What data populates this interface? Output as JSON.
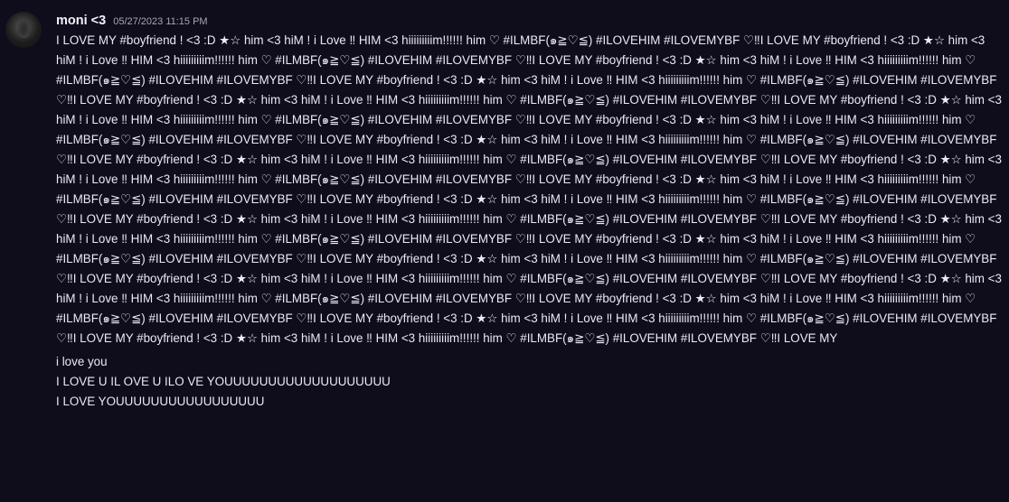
{
  "message": {
    "author": "moni <3",
    "timestamp": "05/27/2023 11:15 PM",
    "avatar_icon": "avatar-icon",
    "body": "I LOVE MY #boyfriend ! <3 :D ★☆ him <3 hiM ! i Love ‼ HIM <3 hiiiiiiiiim!!!!!! him ♡ #ILMBF(๑≧♡≦) #ILOVEHIM #ILOVEMYBF ♡‼I LOVE MY #boyfriend ! <3 :D ★☆ him <3 hiM ! i Love ‼ HIM <3 hiiiiiiiiim!!!!!! him ♡ #ILMBF(๑≧♡≦) #ILOVEHIM #ILOVEMYBF ♡‼I LOVE MY #boyfriend ! <3 :D ★☆ him <3 hiM ! i Love ‼ HIM <3 hiiiiiiiiim!!!!!! him ♡ #ILMBF(๑≧♡≦) #ILOVEHIM #ILOVEMYBF ♡‼I LOVE MY #boyfriend ! <3 :D ★☆ him <3 hiM ! i Love ‼ HIM <3 hiiiiiiiiim!!!!!! him ♡ #ILMBF(๑≧♡≦) #ILOVEHIM #ILOVEMYBF ♡‼I LOVE MY #boyfriend ! <3 :D ★☆ him <3 hiM ! i Love ‼ HIM <3 hiiiiiiiiim!!!!!! him ♡ #ILMBF(๑≧♡≦) #ILOVEHIM #ILOVEMYBF ♡‼I LOVE MY #boyfriend ! <3 :D ★☆ him <3 hiM ! i Love ‼ HIM <3 hiiiiiiiiim!!!!!! him ♡ #ILMBF(๑≧♡≦) #ILOVEHIM #ILOVEMYBF ♡‼I LOVE MY #boyfriend ! <3 :D ★☆ him <3 hiM ! i Love ‼ HIM <3 hiiiiiiiiim!!!!!! him ♡ #ILMBF(๑≧♡≦) #ILOVEHIM #ILOVEMYBF ♡‼I LOVE MY #boyfriend ! <3 :D ★☆ him <3 hiM ! i Love ‼ HIM <3 hiiiiiiiiim!!!!!! him ♡ #ILMBF(๑≧♡≦) #ILOVEHIM #ILOVEMYBF ♡‼I LOVE MY #boyfriend ! <3 :D ★☆ him <3 hiM ! i Love ‼ HIM <3 hiiiiiiiiim!!!!!! him ♡ #ILMBF(๑≧♡≦) #ILOVEHIM #ILOVEMYBF ♡‼I LOVE MY #boyfriend ! <3 :D ★☆ him <3 hiM ! i Love ‼ HIM <3 hiiiiiiiiim!!!!!! him ♡ #ILMBF(๑≧♡≦) #ILOVEHIM #ILOVEMYBF ♡‼I LOVE MY #boyfriend ! <3 :D ★☆ him <3 hiM ! i Love ‼ HIM <3 hiiiiiiiiim!!!!!! him ♡ #ILMBF(๑≧♡≦) #ILOVEHIM #ILOVEMYBF ♡‼I LOVE MY #boyfriend ! <3 :D ★☆ him <3 hiM ! i Love ‼ HIM <3 hiiiiiiiiim!!!!!! him ♡ #ILMBF(๑≧♡≦) #ILOVEHIM #ILOVEMYBF ♡‼I LOVE MY #boyfriend ! <3 :D ★☆ him <3 hiM ! i Love ‼ HIM <3 hiiiiiiiiim!!!!!! him ♡ #ILMBF(๑≧♡≦) #ILOVEHIM #ILOVEMYBF ♡‼I LOVE MY #boyfriend ! <3 :D ★☆ him <3 hiM ! i Love ‼ HIM <3 hiiiiiiiiim!!!!!! him ♡ #ILMBF(๑≧♡≦) #ILOVEHIM #ILOVEMYBF ♡‼I LOVE MY #boyfriend ! <3 :D ★☆ him <3 hiM ! i Love ‼ HIM <3 hiiiiiiiiim!!!!!! him ♡ #ILMBF(๑≧♡≦) #ILOVEHIM #ILOVEMYBF ♡‼I LOVE MY #boyfriend ! <3 :D ★☆ him <3 hiM ! i Love ‼ HIM <3 hiiiiiiiiim!!!!!! him ♡ #ILMBF(๑≧♡≦) #ILOVEHIM #ILOVEMYBF ♡‼I LOVE MY #boyfriend ! <3 :D ★☆ him <3 hiM ! i Love ‼ HIM <3 hiiiiiiiiim!!!!!! him ♡ #ILMBF(๑≧♡≦) #ILOVEHIM #ILOVEMYBF ♡‼I LOVE MY #boyfriend ! <3 :D ★☆ him <3 hiM ! i Love ‼ HIM <3 hiiiiiiiiim!!!!!! him ♡ #ILMBF(๑≧♡≦) #ILOVEHIM #ILOVEMYBF ♡‼I LOVE MY #boyfriend ! <3 :D ★☆ him <3 hiM ! i Love ‼ HIM <3 hiiiiiiiiim!!!!!! him ♡ #ILMBF(๑≧♡≦) #ILOVEHIM #ILOVEMYBF ♡‼I LOVE MY #boyfriend ! <3 :D ★☆ him <3 hiM ! i Love ‼ HIM <3 hiiiiiiiiim!!!!!! him ♡ #ILMBF(๑≧♡≦) #ILOVEHIM #ILOVEMYBF ♡‼I LOVE MY #boyfriend ! <3 :D ★☆ him <3 hiM ! i Love ‼ HIM <3 hiiiiiiiiim!!!!!! him ♡ #ILMBF(๑≧♡≦) #ILOVEHIM #ILOVEMYBF ♡‼I LOVE MY",
    "line_2": "i love you",
    "line_3": "I LOVE U IL OVE U ILO VE  YOUUUUUUUUUUUUUUUUUUU",
    "line_4": "I LOVE YOUUUUUUUUUUUUUUUUU"
  },
  "colors": {
    "background": "#0f0c1c",
    "text": "#ece9f3",
    "timestamp": "#a9a5b6"
  }
}
